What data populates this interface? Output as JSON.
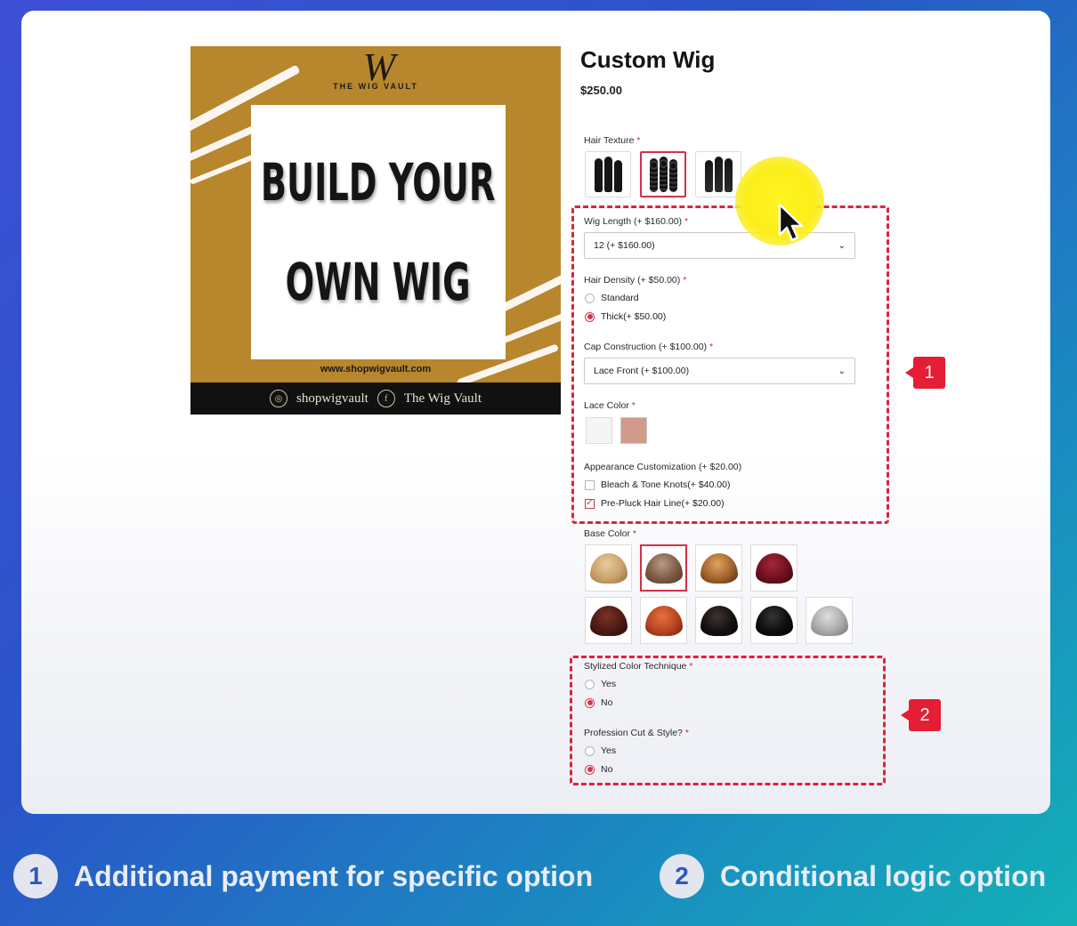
{
  "product": {
    "title": "Custom Wig",
    "price": "$250.00"
  },
  "promo_image": {
    "logo_mark": "W",
    "logo_text": "THE WIG VAULT",
    "headline_line1": "BUILD YOUR",
    "headline_line2": "OWN WIG",
    "url": "www.shopwigvault.com",
    "social_instagram": "shopwigvault",
    "social_facebook": "The Wig Vault",
    "colors": {
      "gold": "#b8862c",
      "black": "#111111"
    }
  },
  "hair_texture": {
    "label": "Hair Texture",
    "required": "*",
    "options": [
      "straight",
      "deep-wave",
      "loose-wave"
    ],
    "selected_index": 1
  },
  "wig_length": {
    "label": "Wig Length (+ $160.00)",
    "required": "*",
    "value": "12 (+ $160.00)"
  },
  "hair_density": {
    "label": "Hair Density (+ $50.00)",
    "required": "*",
    "options": [
      "Standard",
      "Thick(+ $50.00)"
    ],
    "selected_index": 1
  },
  "cap_construction": {
    "label": "Cap Construction (+ $100.00)",
    "required": "*",
    "value": "Lace Front (+ $100.00)"
  },
  "lace_color": {
    "label": "Lace Color",
    "required": "*",
    "options": [
      {
        "name": "transparent",
        "color": "#f5f5f5"
      },
      {
        "name": "medium-brown",
        "color": "#d29a8a"
      }
    ]
  },
  "appearance": {
    "label": "Appearance Customization (+ $20.00)",
    "options": [
      {
        "label": "Bleach & Tone Knots(+ $40.00)",
        "checked": false
      },
      {
        "label": "Pre-Pluck Hair Line(+ $20.00)",
        "checked": true
      }
    ]
  },
  "base_color": {
    "label": "Base Color",
    "required": "*",
    "selected_index": 1,
    "options": [
      {
        "name": "honey-blonde",
        "color": "#c9a06a"
      },
      {
        "name": "ash-brown",
        "color": "#7d5a44"
      },
      {
        "name": "golden-brown",
        "color": "#a0622a"
      },
      {
        "name": "burgundy",
        "color": "#6e0f1e"
      },
      {
        "name": "dark-auburn",
        "color": "#4b1a14"
      },
      {
        "name": "copper-red",
        "color": "#b8431f"
      },
      {
        "name": "jet-black",
        "color": "#141010"
      },
      {
        "name": "natural-black",
        "color": "#0d0d0d"
      },
      {
        "name": "silver-grey",
        "color": "#a9a9a9"
      }
    ]
  },
  "stylized_color": {
    "label": "Stylized Color Technique",
    "required": "*",
    "options": [
      "Yes",
      "No"
    ],
    "selected_index": 1
  },
  "cut_style": {
    "label": "Profession Cut & Style?",
    "required": "*",
    "options": [
      "Yes",
      "No"
    ],
    "selected_index": 1
  },
  "markers": [
    "1",
    "2"
  ],
  "legend": [
    {
      "num": "1",
      "text": "Additional payment for specific option"
    },
    {
      "num": "2",
      "text": "Conditional logic option"
    }
  ],
  "accent_color": "#e2213c"
}
